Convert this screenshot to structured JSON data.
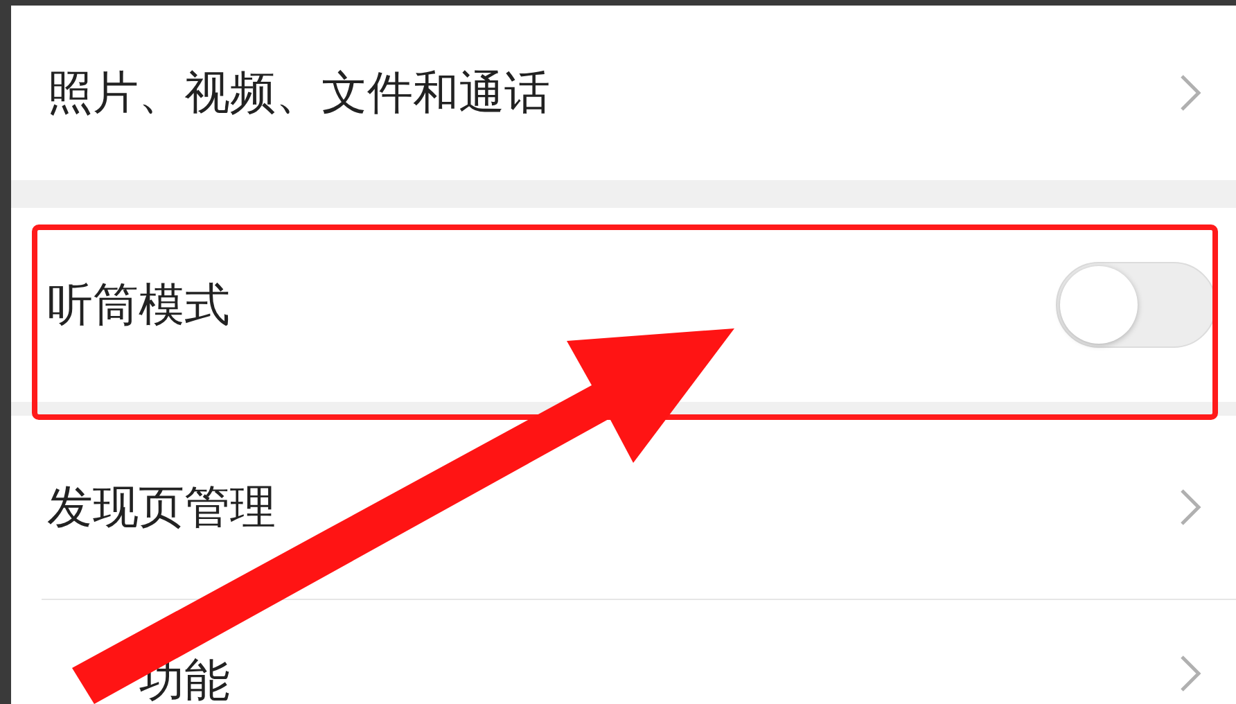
{
  "groups": [
    {
      "items": [
        {
          "kind": "link",
          "label": "照片、视频、文件和通话"
        }
      ]
    },
    {
      "items": [
        {
          "kind": "toggle",
          "label": "听筒模式",
          "on": false
        }
      ]
    },
    {
      "items": [
        {
          "kind": "link",
          "label": "发现页管理"
        },
        {
          "kind": "link",
          "label": "功能"
        }
      ]
    }
  ],
  "annotations": [
    {
      "kind": "box"
    },
    {
      "kind": "arrow"
    }
  ]
}
